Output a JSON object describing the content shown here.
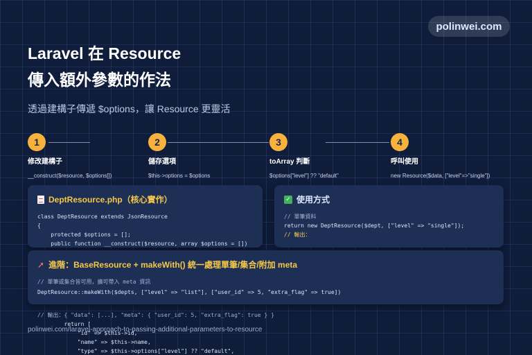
{
  "brand": "polinwei.com",
  "title_line1": "Laravel 在 Resource",
  "title_line2": "傳入額外參數的作法",
  "subtitle": "透過建構子傳遞 $options，讓 Resource 更靈活",
  "steps": [
    {
      "num": "1",
      "label": "修改建構子",
      "code": "__construct($resource, $options[])"
    },
    {
      "num": "2",
      "label": "儲存選項",
      "code": "$this->options = $options"
    },
    {
      "num": "3",
      "label": "toArray 判斷",
      "code": "$options[\"level\"] ?? \"default\""
    },
    {
      "num": "4",
      "label": "呼叫使用",
      "code": "new Resource($data, [\"level\"=>\"single\"])"
    }
  ],
  "card_left": {
    "title": "DeptResource.php（核心實作）",
    "lines": [
      "class DeptResource extends JsonResource",
      "{",
      "    protected $options = [];",
      "",
      "    public function __construct($resource, array $options = [])"
    ]
  },
  "card_right": {
    "title": "使用方式",
    "comment1": "// 單筆資料",
    "code1": "return new DeptResource($dept, [\"level\" => \"single\"]);",
    "comment2": "// 輸出："
  },
  "card_bottom": {
    "title": "進階：BaseResource + makeWith() 統一處理單筆/集合/附加 meta",
    "comment": "// 單筆或集合皆可用，擴可帶入 meta 資訊",
    "code": "DeptResource::makeWith($depts, [\"level\" => \"list\"], [\"user_id\" => 5, \"extra_flag\" => true])"
  },
  "behind_lines": [
    "// 輸出：{ \"data\": [...], \"meta\": { \"user_id\": 5, \"extra_flag\": true } }",
    "        return [",
    "            \"id\" => $this->id,",
    "            \"name\" => $this->name,",
    "            \"type\" => $this->options[\"level\"] ?? \"default\","
  ],
  "footer_url": "polinwei.com/laravel-approach-to-passing-additional-parameters-to-resource",
  "colors": {
    "background": "#0f1c3a",
    "card": "#1d2f55",
    "accent": "#f6b23c",
    "title_yellow": "#f6c84a"
  }
}
